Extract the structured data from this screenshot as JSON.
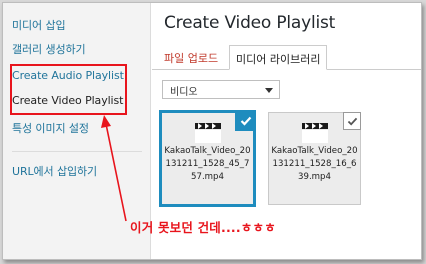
{
  "sidebar": {
    "items": [
      {
        "label": "미디어 삽입"
      },
      {
        "label": "갤러리 생성하기"
      },
      {
        "label": "Create Audio Playlist"
      },
      {
        "label": "Create Video Playlist"
      },
      {
        "label": "특성 이미지 설정"
      },
      {
        "label": "URL에서 삽입하기"
      }
    ]
  },
  "main": {
    "title": "Create Video Playlist",
    "tabs": [
      {
        "label": "파일 업로드"
      },
      {
        "label": "미디어 라이브러리"
      }
    ],
    "filter": {
      "selected": "비디오"
    },
    "attachments": [
      {
        "filename": "KakaoTalk_Video_20131211_1528_45_757.mp4",
        "selected": true
      },
      {
        "filename": "KakaoTalk_Video_20131211_1528_16_639.mp4",
        "selected": false
      }
    ]
  },
  "annotation": {
    "text": "이거 못보던 건데....ㅎㅎㅎ"
  },
  "colors": {
    "accent": "#1e8cbe",
    "link": "#21759b",
    "annotation": "#e8141c"
  },
  "icons": {
    "thumbnail": "video-clapper-icon",
    "selected": "checkmark-icon"
  }
}
